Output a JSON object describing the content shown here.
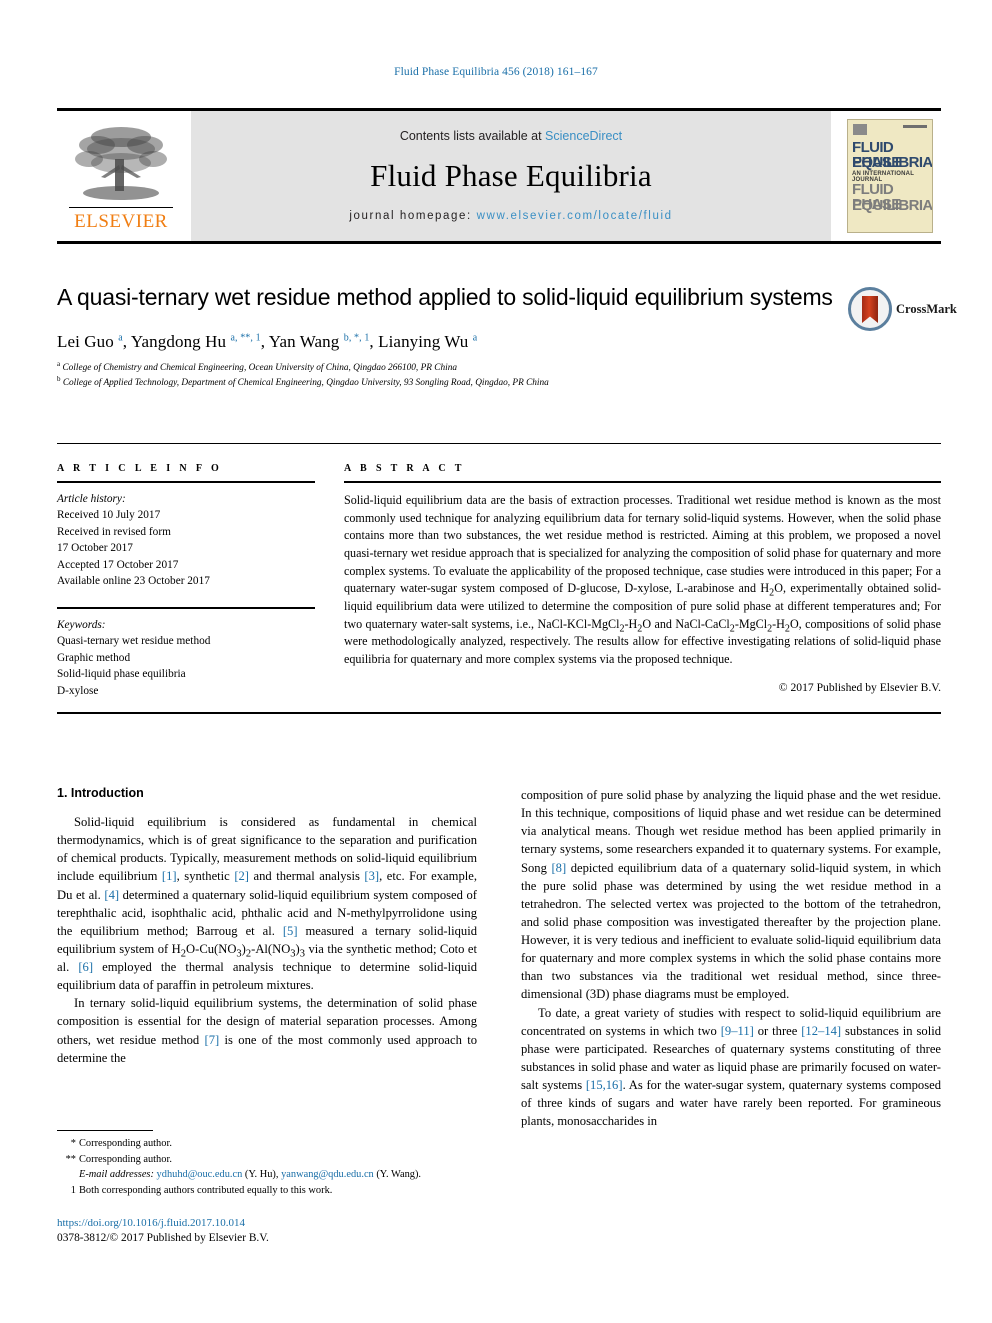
{
  "running_head": "Fluid Phase Equilibria 456 (2018) 161–167",
  "masthead": {
    "publisher": "ELSEVIER",
    "contents_prefix": "Contents lists available at ",
    "contents_link": "ScienceDirect",
    "journal_title": "Fluid Phase Equilibria",
    "homepage_prefix": "journal homepage: ",
    "homepage_url": "www.elsevier.com/locate/fluid",
    "cover": {
      "line1": "FLUID PHASE",
      "line2": "EQUILIBRIA",
      "line3": "AN INTERNATIONAL JOURNAL",
      "line4": "FLUID PHASE",
      "line5": "EQUILIBRIA"
    }
  },
  "crossmark": {
    "label": "CrossMark"
  },
  "article": {
    "title": "A quasi-ternary wet residue method applied to solid-liquid equilibrium systems",
    "authors_html": "Lei Guo <sup>a</sup>, Yangdong Hu <sup>a, **, 1</sup>, Yan Wang <sup>b, *, 1</sup>, Lianying Wu <sup>a</sup>",
    "affiliation_a": "College of Chemistry and Chemical Engineering, Ocean University of China, Qingdao 266100, PR China",
    "affiliation_b": "College of Applied Technology, Department of Chemical Engineering, Qingdao University, 93 Songling Road, Qingdao, PR China"
  },
  "info": {
    "heading": "A R T I C L E   I N F O",
    "history_label": "Article history:",
    "history": [
      "Received 10 July 2017",
      "Received in revised form",
      "17 October 2017",
      "Accepted 17 October 2017",
      "Available online 23 October 2017"
    ],
    "keywords_label": "Keywords:",
    "keywords": [
      "Quasi-ternary wet residue method",
      "Graphic method",
      "Solid-liquid phase equilibria",
      "D-xylose"
    ]
  },
  "abstract": {
    "heading": "A B S T R A C T",
    "text_html": "Solid-liquid equilibrium data are the basis of extraction processes. Traditional wet residue method is known as the most commonly used technique for analyzing equilibrium data for ternary solid-liquid systems. However, when the solid phase contains more than two substances, the wet residue method is restricted. Aiming at this problem, we proposed a novel quasi-ternary wet residue approach that is specialized for analyzing the composition of solid phase for quaternary and more complex systems. To evaluate the applicability of the proposed technique, case studies were introduced in this paper; For a quaternary water-sugar system composed of D-glucose, D-xylose, L-arabinose and H<sub>2</sub>O, experimentally obtained solid-liquid equilibrium data were utilized to determine the composition of pure solid phase at different temperatures and; For two quaternary water-salt systems, i.e., NaCl-KCl-MgCl<sub>2</sub>-H<sub>2</sub>O and NaCl-CaCl<sub>2</sub>-MgCl<sub>2</sub>-H<sub>2</sub>O, compositions of solid phase were methodologically analyzed, respectively. The results allow for effective investigating relations of solid-liquid phase equilibria for quaternary and more complex systems via the proposed technique.",
    "copyright": "© 2017 Published by Elsevier B.V."
  },
  "body": {
    "section_heading": "1. Introduction",
    "left_p1_html": "Solid-liquid equilibrium is considered as fundamental in chemical thermodynamics, which is of great significance to the separation and purification of chemical products. Typically, measurement methods on solid-liquid equilibrium include equilibrium <span class=\"ref\">[1]</span>, synthetic <span class=\"ref\">[2]</span> and thermal analysis <span class=\"ref\">[3]</span>, etc. For example, Du et al. <span class=\"ref\">[4]</span> determined a quaternary solid-liquid equilibrium system composed of terephthalic acid, isophthalic acid, phthalic acid and N-methylpyrrolidone using the equilibrium method; Barroug et al. <span class=\"ref\">[5]</span> measured a ternary solid-liquid equilibrium system of H<sub>2</sub>O-Cu(NO<sub>3</sub>)<sub>2</sub>-Al(NO<sub>3</sub>)<sub>3</sub> via the synthetic method; Coto et al. <span class=\"ref\">[6]</span> employed the thermal analysis technique to determine solid-liquid equilibrium data of paraffin in petroleum mixtures.",
    "left_p2_html": "In ternary solid-liquid equilibrium systems, the determination of solid phase composition is essential for the design of material separation processes. Among others, wet residue method <span class=\"ref\">[7]</span> is one of the most commonly used approach to determine the",
    "right_p1_html": "composition of pure solid phase by analyzing the liquid phase and the wet residue. In this technique, compositions of liquid phase and wet residue can be determined via analytical means. Though wet residue method has been applied primarily in ternary systems, some researchers expanded it to quaternary systems. For example, Song <span class=\"ref\">[8]</span> depicted equilibrium data of a quaternary solid-liquid system, in which the pure solid phase was determined by using the wet residue method in a tetrahedron. The selected vertex was projected to the bottom of the tetrahedron, and solid phase composition was investigated thereafter by the projection plane. However, it is very tedious and inefficient to evaluate solid-liquid equilibrium data for quaternary and more complex systems in which the solid phase contains more than two substances via the traditional wet residual method, since three-dimensional (3D) phase diagrams must be employed.",
    "right_p2_html": "To date, a great variety of studies with respect to solid-liquid equilibrium are concentrated on systems in which two <span class=\"ref\">[9–11]</span> or three <span class=\"ref\">[12–14]</span> substances in solid phase were participated. Researches of quaternary systems constituting of three substances in solid phase and water as liquid phase are primarily focused on water-salt systems <span class=\"ref\">[15,16]</span>. As for the water-sugar system, quaternary systems composed of three kinds of sugars and water have rarely been reported. For gramineous plants, monosaccharides in"
  },
  "footnotes": {
    "star_mark": "*",
    "star_text": "Corresponding author.",
    "dstar_mark": "**",
    "dstar_text": "Corresponding author.",
    "email_html": "<span class=\"it\">E-mail addresses:</span> <span class=\"mail\">ydhuhd@ouc.edu.cn</span> (Y. Hu), <span class=\"mail\">yanwang@qdu.edu.cn</span> (Y. Wang).",
    "one_mark": "1",
    "one_text": "Both corresponding authors contributed equally to this work."
  },
  "footer": {
    "doi": "https://doi.org/10.1016/j.fluid.2017.10.014",
    "issn": "0378-3812/© 2017 Published by Elsevier B.V."
  }
}
